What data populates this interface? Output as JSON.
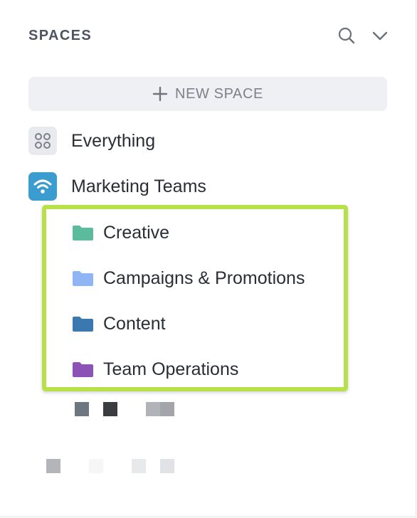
{
  "header": {
    "title": "SPACES",
    "search_icon": "search-icon",
    "collapse_icon": "chevron-down-icon"
  },
  "new_space": {
    "label": "NEW SPACE",
    "icon": "plus-icon"
  },
  "spaces": [
    {
      "label": "Everything",
      "icon": "grid-icon"
    },
    {
      "label": "Marketing Teams",
      "icon": "wifi-icon",
      "color": "#3b9cd0"
    }
  ],
  "folders": [
    {
      "label": "Creative",
      "color": "#5dbb9d"
    },
    {
      "label": "Campaigns & Promotions",
      "color": "#8fb5f5"
    },
    {
      "label": "Content",
      "color": "#3c78b0"
    },
    {
      "label": "Team Operations",
      "color": "#8d52b6"
    }
  ],
  "highlight_color": "#b8e04a"
}
